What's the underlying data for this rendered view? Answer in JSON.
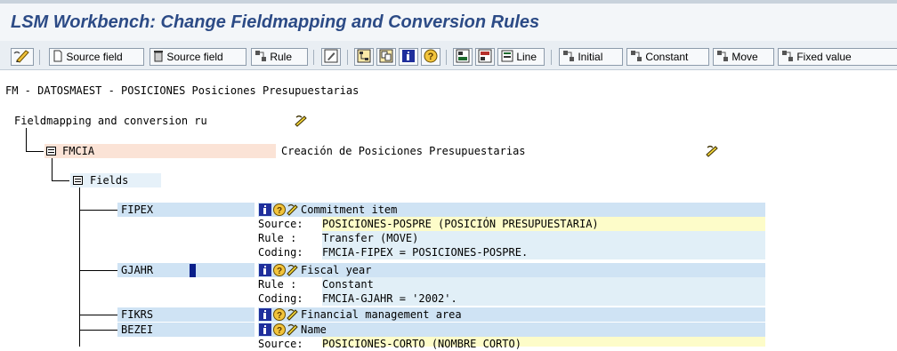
{
  "app": {
    "title": "LSM Workbench: Change Fieldmapping and Conversion Rules"
  },
  "toolbar": {
    "source_field_1": "Source field",
    "source_field_2": "Source field",
    "rule": "Rule",
    "line": "Line",
    "initial": "Initial",
    "constant": "Constant",
    "move": "Move",
    "fixed_value": "Fixed value"
  },
  "header": {
    "path": "FM - DATOSMAEST - POSICIONES Posiciones Presupuestarias"
  },
  "tree": {
    "root": {
      "label": "Fieldmapping and conversion ru"
    },
    "structure": {
      "name": "FMCIA",
      "description": "Creación de Posiciones Presupuestarias"
    },
    "fields_node": {
      "label": "Fields"
    },
    "items": [
      {
        "name": "FIPEX",
        "title": "Commitment item",
        "source_label": "Source:",
        "source": "POSICIONES-POSPRE (POSICIÓN PRESUPUESTARIA)",
        "rule_label": "Rule :",
        "rule": "Transfer (MOVE)",
        "coding_label": "Coding:",
        "coding": "FMCIA-FIPEX = POSICIONES-POSPRE."
      },
      {
        "name": "GJAHR",
        "title": "Fiscal year",
        "rule_label": "Rule :",
        "rule": "Constant",
        "coding_label": "Coding:",
        "coding": "FMCIA-GJAHR = '2002'."
      },
      {
        "name": "FIKRS",
        "title": "Financial management area"
      },
      {
        "name": "BEZEI",
        "title": "Name",
        "source_label": "Source:",
        "source": "POSICIONES-CORTO (NOMBRE CORTO)"
      }
    ]
  },
  "colors": {
    "title": "#2c4b86",
    "field_band": "#cfe3f4",
    "source_band": "#fdfcc9",
    "detail_band": "#e1eff7",
    "structure_band": "#fbe3d6",
    "info_icon": "#1f2f9c"
  }
}
